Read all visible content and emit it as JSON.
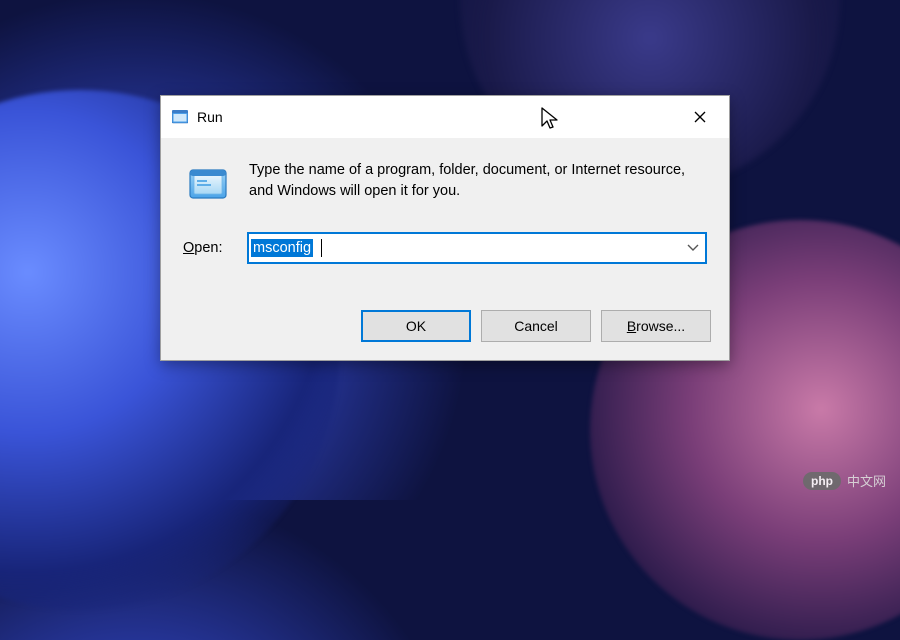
{
  "dialog": {
    "title": "Run",
    "message": "Type the name of a program, folder, document, or Internet resource, and Windows will open it for you.",
    "open_label_pre": "O",
    "open_label_post": "pen:",
    "input_value": "msconfig",
    "buttons": {
      "ok": "OK",
      "cancel": "Cancel",
      "browse_pre": "B",
      "browse_post": "rowse..."
    }
  },
  "watermark": {
    "badge": "php",
    "text": "中文网"
  }
}
